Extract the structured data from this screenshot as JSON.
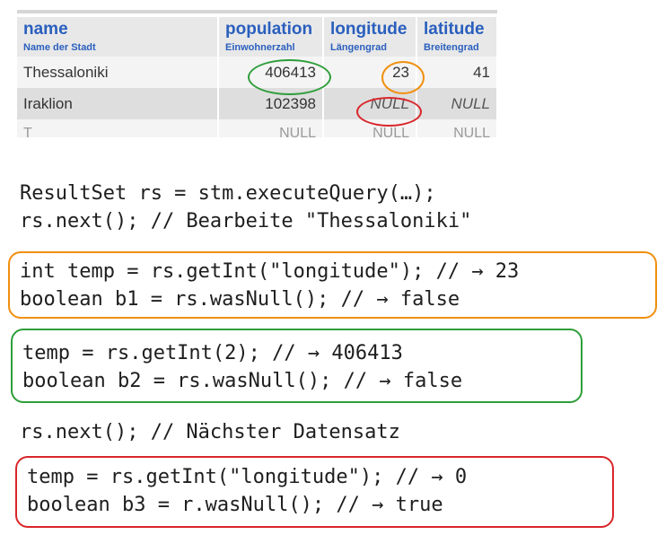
{
  "table": {
    "columns": [
      {
        "title": "name",
        "subtitle": "Name der Stadt"
      },
      {
        "title": "population",
        "subtitle": "Einwohnerzahl"
      },
      {
        "title": "longitude",
        "subtitle": "Längengrad"
      },
      {
        "title": "latitude",
        "subtitle": "Breitengrad"
      }
    ],
    "rows": [
      {
        "name": "Thessaloniki",
        "population": "406413",
        "longitude": "23",
        "latitude": "41"
      },
      {
        "name": "Iraklion",
        "population": "102398",
        "longitude": "NULL",
        "latitude": "NULL"
      }
    ],
    "partial_row": {
      "name": "T",
      "population": "NULL",
      "longitude": "NULL",
      "latitude": "NULL"
    }
  },
  "annotations": {
    "green": "#2e9e3a",
    "orange": "#f0900f",
    "red": "#d9262a"
  },
  "code": {
    "intro_1": "ResultSet rs = stm.executeQuery(…);",
    "intro_2": "rs.next(); // Bearbeite \"Thessaloniki\"",
    "orange_1": "int temp = rs.getInt(\"longitude\"); // → 23",
    "orange_2": "boolean b1 = rs.wasNull(); // → false",
    "green_1": "temp = rs.getInt(2); // → 406413",
    "green_2": "boolean b2 = rs.wasNull(); // → false",
    "next": "rs.next(); // Nächster Datensatz",
    "red_1": "temp = rs.getInt(\"longitude\"); // → 0",
    "red_2": "boolean b3 = r.wasNull(); // → true"
  }
}
